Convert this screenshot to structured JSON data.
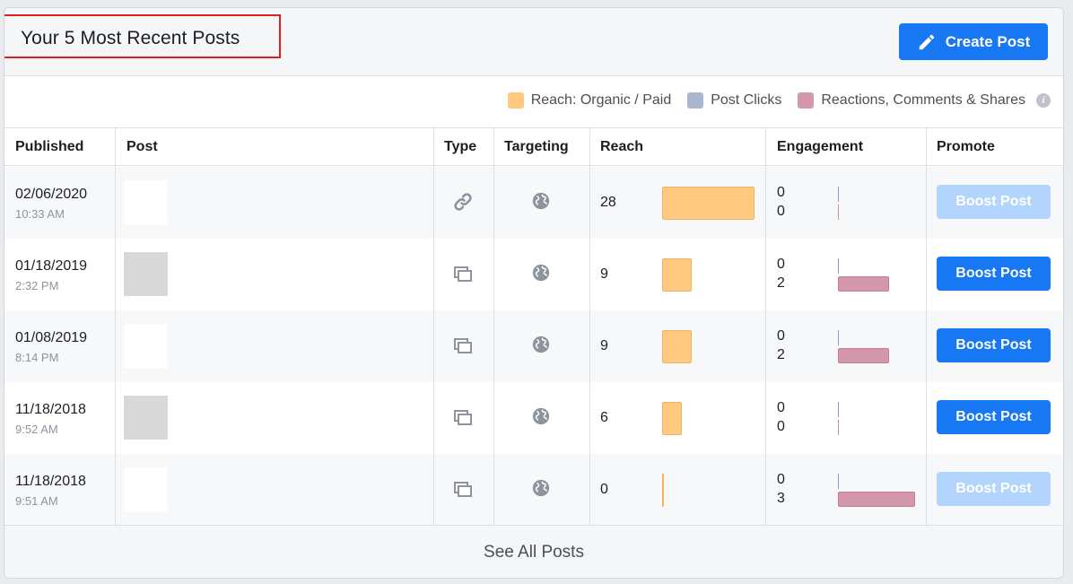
{
  "header": {
    "title": "Your 5 Most Recent Posts",
    "create_label": "Create Post"
  },
  "legend": {
    "items": [
      {
        "label": "Reach: Organic / Paid",
        "color": "#ffc97f"
      },
      {
        "label": "Post Clicks",
        "color": "#a9b5d1"
      },
      {
        "label": "Reactions, Comments & Shares",
        "color": "#d598ab"
      }
    ],
    "info_icon": "i"
  },
  "columns": [
    "Published",
    "Post",
    "Type",
    "Targeting",
    "Reach",
    "Engagement",
    "Promote"
  ],
  "rows": [
    {
      "date": "02/06/2020",
      "time": "10:33 AM",
      "thumb": "white",
      "type_icon": "link-icon",
      "reach": "28",
      "clicks": "0",
      "reactions": "0",
      "boost_label": "Boost Post",
      "boost_enabled": false
    },
    {
      "date": "01/18/2019",
      "time": "2:32 PM",
      "thumb": "grey",
      "type_icon": "album-icon",
      "reach": "9",
      "clicks": "0",
      "reactions": "2",
      "boost_label": "Boost Post",
      "boost_enabled": true
    },
    {
      "date": "01/08/2019",
      "time": "8:14 PM",
      "thumb": "white",
      "type_icon": "album-icon",
      "reach": "9",
      "clicks": "0",
      "reactions": "2",
      "boost_label": "Boost Post",
      "boost_enabled": true
    },
    {
      "date": "11/18/2018",
      "time": "9:52 AM",
      "thumb": "grey",
      "type_icon": "album-icon",
      "reach": "6",
      "clicks": "0",
      "reactions": "0",
      "boost_label": "Boost Post",
      "boost_enabled": true
    },
    {
      "date": "11/18/2018",
      "time": "9:51 AM",
      "thumb": "white",
      "type_icon": "album-icon",
      "reach": "0",
      "clicks": "0",
      "reactions": "3",
      "boost_label": "Boost Post",
      "boost_enabled": false
    }
  ],
  "footer": {
    "see_all_label": "See All Posts"
  },
  "colors": {
    "accent": "#1877f2",
    "accent_disabled": "#b3d4fc",
    "reach": "#ffc97f",
    "clicks": "#a9b5d1",
    "reactions": "#d598ab"
  }
}
